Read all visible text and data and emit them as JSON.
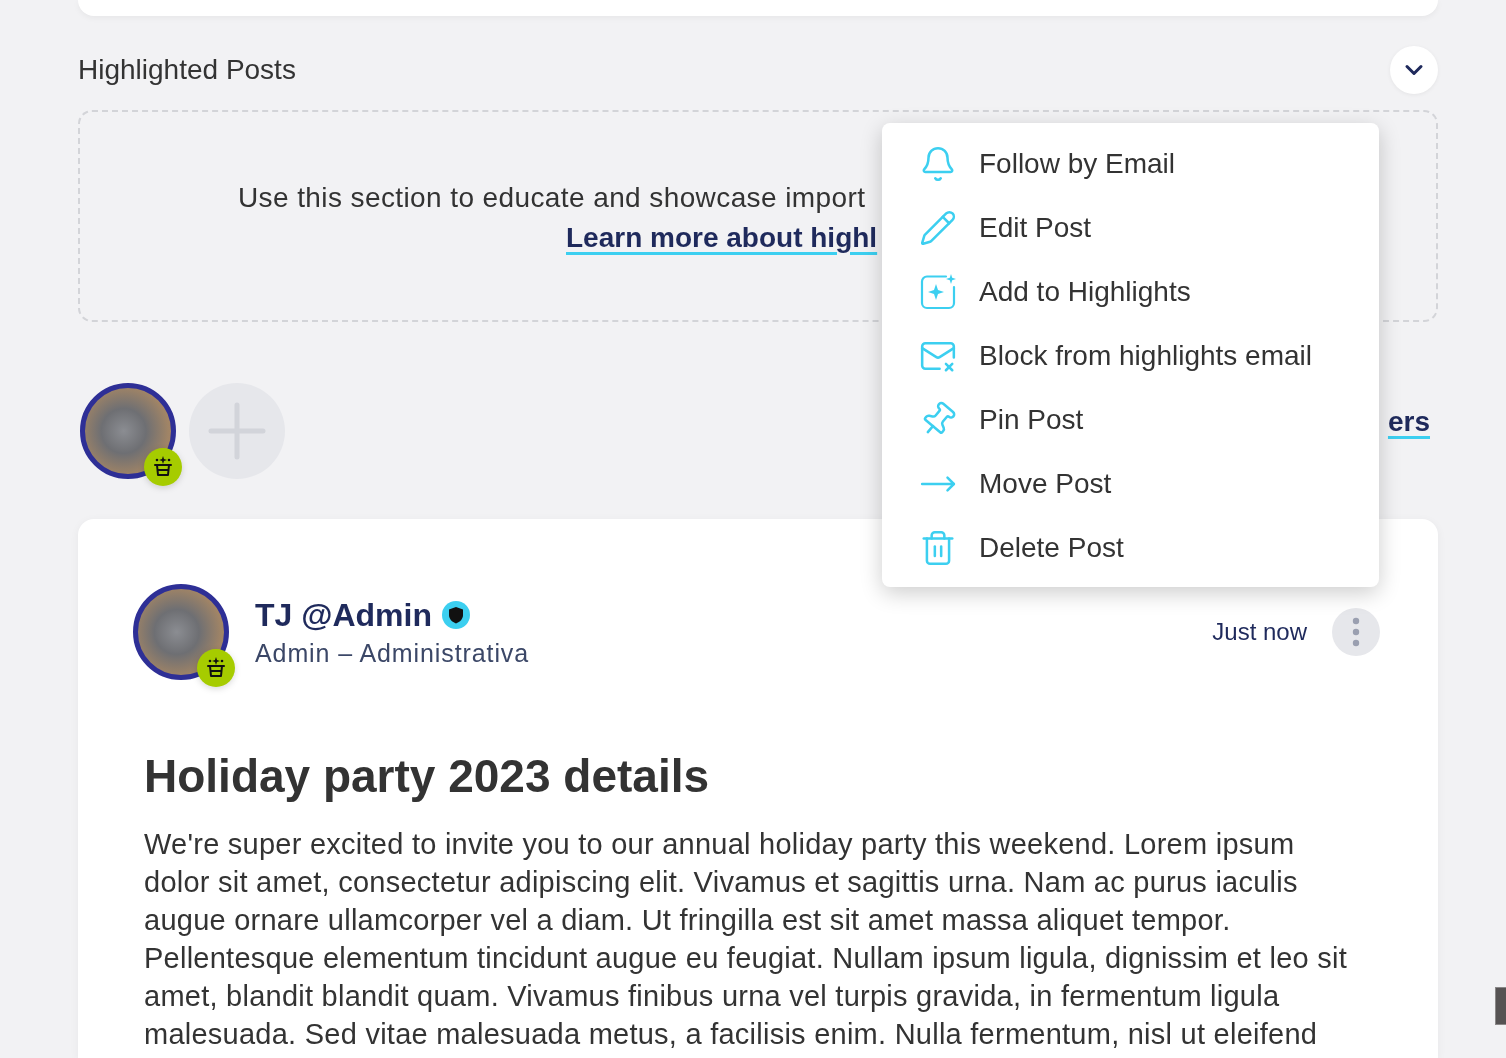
{
  "highlighted_posts": {
    "title": "Highlighted Posts",
    "empty_state": {
      "text": "Use this section to educate and showcase import",
      "link": "Learn more about highl"
    }
  },
  "member_bar": {
    "link": "ers"
  },
  "post": {
    "author": "TJ @Admin",
    "role": "Admin – Administrativa",
    "time": "Just now",
    "title": "Holiday party 2023 details",
    "body": "We're super excited to invite you to our annual holiday party this weekend. Lorem ipsum dolor sit amet, consectetur adipiscing elit. Vivamus et sagittis urna. Nam ac purus iaculis augue ornare ullamcorper vel a diam. Ut fringilla est sit amet massa aliquet tempor. Pellentesque elementum tincidunt augue eu feugiat. Nullam ipsum ligula, dignissim et leo sit amet, blandit blandit quam. Vivamus finibus urna vel turpis gravida, in fermentum ligula malesuada. Sed vitae malesuada metus, a facilisis enim. Nulla fermentum, nisl ut eleifend"
  },
  "post_menu": {
    "items": [
      {
        "label": "Follow by Email"
      },
      {
        "label": "Edit Post"
      },
      {
        "label": "Add to Highlights"
      },
      {
        "label": "Block from highlights email"
      },
      {
        "label": "Pin Post"
      },
      {
        "label": "Move Post"
      },
      {
        "label": "Delete Post"
      }
    ]
  }
}
